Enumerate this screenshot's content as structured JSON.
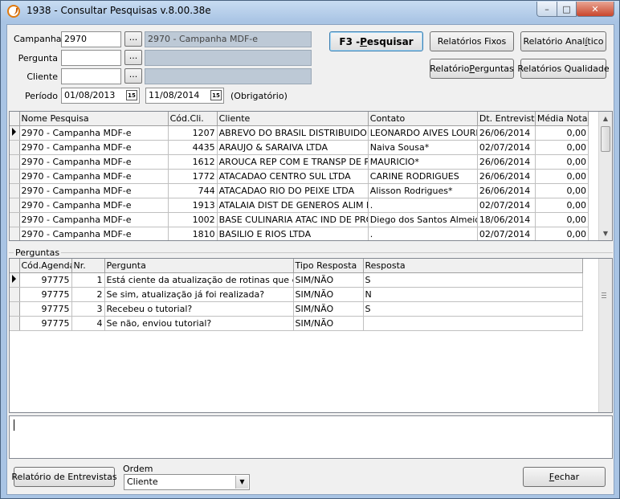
{
  "window": {
    "title": "1938 - Consultar Pesquisas  v.8.00.38e"
  },
  "form": {
    "campanha_label": "Campanha",
    "campanha_code": "2970",
    "campanha_desc": "2970 - Campanha MDF-e",
    "pergunta_label": "Pergunta",
    "pergunta_code": "",
    "pergunta_desc": "",
    "cliente_label": "Cliente",
    "cliente_code": "",
    "cliente_desc": "",
    "periodo_label": "Período",
    "periodo_from": "01/08/2013",
    "periodo_to": "11/08/2014",
    "periodo_note": "(Obrigatório)",
    "lookup_label": "...",
    "calendar_label": "15"
  },
  "buttons": {
    "pesquisar_prefix": "F3 - ",
    "pesquisar_u": "P",
    "pesquisar_rest": "esquisar",
    "relatorios_fixos": "Relatórios Fixos",
    "relatorio_analitico_a": "Relatório Anal",
    "relatorio_analitico_u": "í",
    "relatorio_analitico_b": "tico",
    "relatorio_perguntas_a": "Relatório ",
    "relatorio_perguntas_u": "P",
    "relatorio_perguntas_b": "erguntas",
    "relatorios_qualidade": "Relatórios Qualidade",
    "relatorio_entrevistas": "Relatório de Entrevistas",
    "fechar_u": "F",
    "fechar_rest": "echar"
  },
  "surveys": {
    "columns": [
      "Nome Pesquisa",
      "Cód.Cli.",
      "Cliente",
      "Contato",
      "Dt. Entrevista",
      "Média Nota"
    ],
    "rows": [
      [
        "2970 - Campanha MDF-e",
        "1207",
        "ABREVO DO BRASIL DISTRIBUIDORA",
        "LEONARDO AIVES LOUREÇO",
        "26/06/2014",
        "0,00"
      ],
      [
        "2970 - Campanha MDF-e",
        "4435",
        "ARAUJO & SARAIVA LTDA",
        "Naiva Sousa*",
        "02/07/2014",
        "0,00"
      ],
      [
        "2970 - Campanha MDF-e",
        "1612",
        "AROUCA REP COM E TRANSP DE PROD",
        "MAURICIO*",
        "26/06/2014",
        "0,00"
      ],
      [
        "2970 - Campanha MDF-e",
        "1772",
        "ATACADAO CENTRO SUL LTDA",
        "CARINE RODRIGUES",
        "26/06/2014",
        "0,00"
      ],
      [
        "2970 - Campanha MDF-e",
        "744",
        "ATACADAO RIO DO PEIXE LTDA",
        "Alisson Rodrigues*",
        "26/06/2014",
        "0,00"
      ],
      [
        "2970 - Campanha MDF-e",
        "1913",
        "ATALAIA DIST DE GENEROS ALIM LTDA",
        ".",
        "02/07/2014",
        "0,00"
      ],
      [
        "2970 - Campanha MDF-e",
        "1002",
        "BASE CULINARIA ATAC IND DE PROD",
        "Diego dos Santos Almeida*",
        "18/06/2014",
        "0,00"
      ],
      [
        "2970 - Campanha MDF-e",
        "1810",
        "BASILIO E RIOS LTDA",
        ".",
        "02/07/2014",
        "0,00"
      ]
    ]
  },
  "questions": {
    "group_label": "Perguntas",
    "columns": [
      "Cód.Agenda",
      "Nr.",
      "Pergunta",
      "Tipo Resposta",
      "Resposta"
    ],
    "rows": [
      [
        "97775",
        "1",
        "Está ciente da atualização de rotinas que envolvem",
        "SIM/NÃO",
        "S"
      ],
      [
        "97775",
        "2",
        "Se sim, atualização já foi realizada?",
        "SIM/NÃO",
        "N"
      ],
      [
        "97775",
        "3",
        "Recebeu o tutorial?",
        "SIM/NÃO",
        "S"
      ],
      [
        "97775",
        "4",
        "Se não, enviou tutorial?",
        "SIM/NÃO",
        ""
      ]
    ]
  },
  "ordem": {
    "label": "Ordem",
    "value": "Cliente"
  },
  "colors": {
    "titlebar": "#a9c4e4",
    "readonly_field": "#bdc9d6",
    "close_button": "#c9462c"
  }
}
